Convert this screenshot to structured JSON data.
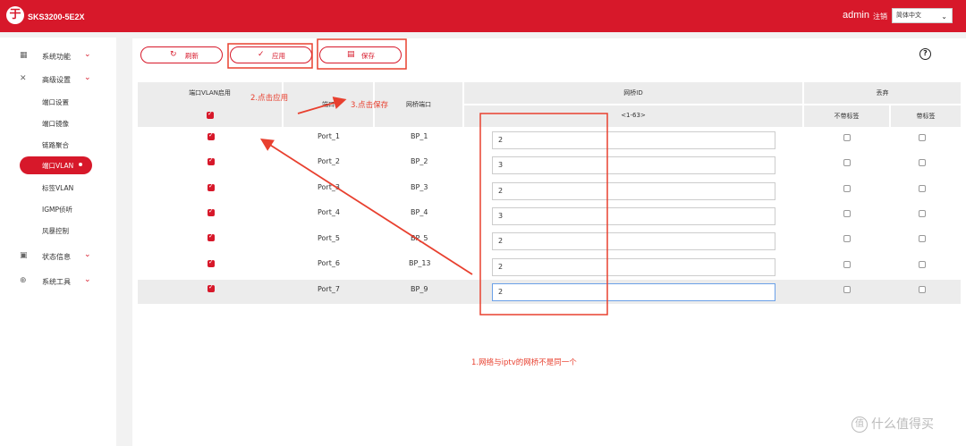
{
  "header": {
    "logo_glyph": "于",
    "model": "SKS3200-5E2X",
    "user": "admin",
    "logout": "注销",
    "language": "简体中文"
  },
  "sidebar": {
    "groups": [
      {
        "label": "系统功能",
        "icon": "grid-icon"
      },
      {
        "label": "高级设置",
        "icon": "wrench-icon"
      },
      {
        "label": "状态信息",
        "icon": "monitor-icon"
      },
      {
        "label": "系统工具",
        "icon": "globe-icon"
      }
    ],
    "sub_items": [
      "端口设置",
      "端口镜像",
      "链路聚合",
      "端口VLAN",
      "标签VLAN",
      "IGMP侦听",
      "风暴控制"
    ]
  },
  "toolbar": {
    "refresh_label": "刷新",
    "apply_label": "应用",
    "save_label": "保存",
    "help": "?"
  },
  "table": {
    "headers": {
      "vlan_enable": "端口VLAN启用",
      "port": "端口",
      "bridge_port": "网桥端口",
      "bridge_id": "网桥ID",
      "bridge_range": "<1-63>",
      "discard": "丢弃",
      "untagged": "不带标签",
      "tagged": "带标签"
    },
    "rows": [
      {
        "port": "Port_1",
        "bp": "BP_1",
        "id": "2",
        "enabled": true,
        "untagged": false,
        "tagged": false
      },
      {
        "port": "Port_2",
        "bp": "BP_2",
        "id": "3",
        "enabled": true,
        "untagged": false,
        "tagged": false
      },
      {
        "port": "Port_3",
        "bp": "BP_3",
        "id": "2",
        "enabled": true,
        "untagged": false,
        "tagged": false
      },
      {
        "port": "Port_4",
        "bp": "BP_4",
        "id": "3",
        "enabled": true,
        "untagged": false,
        "tagged": false
      },
      {
        "port": "Port_5",
        "bp": "BP_5",
        "id": "2",
        "enabled": true,
        "untagged": false,
        "tagged": false
      },
      {
        "port": "Port_6",
        "bp": "BP_13",
        "id": "2",
        "enabled": true,
        "untagged": false,
        "tagged": false
      },
      {
        "port": "Port_7",
        "bp": "BP_9",
        "id": "2",
        "enabled": true,
        "untagged": false,
        "tagged": false
      }
    ]
  },
  "annotations": {
    "step2": "2.点击应用",
    "step3": "3.点击保存",
    "note1": "1.网络与iptv的网桥不是同一个"
  },
  "watermark": {
    "glyph": "值",
    "text": "什么值得买"
  },
  "colors": {
    "brand": "#d7182a",
    "annotation": "#e8402f"
  }
}
